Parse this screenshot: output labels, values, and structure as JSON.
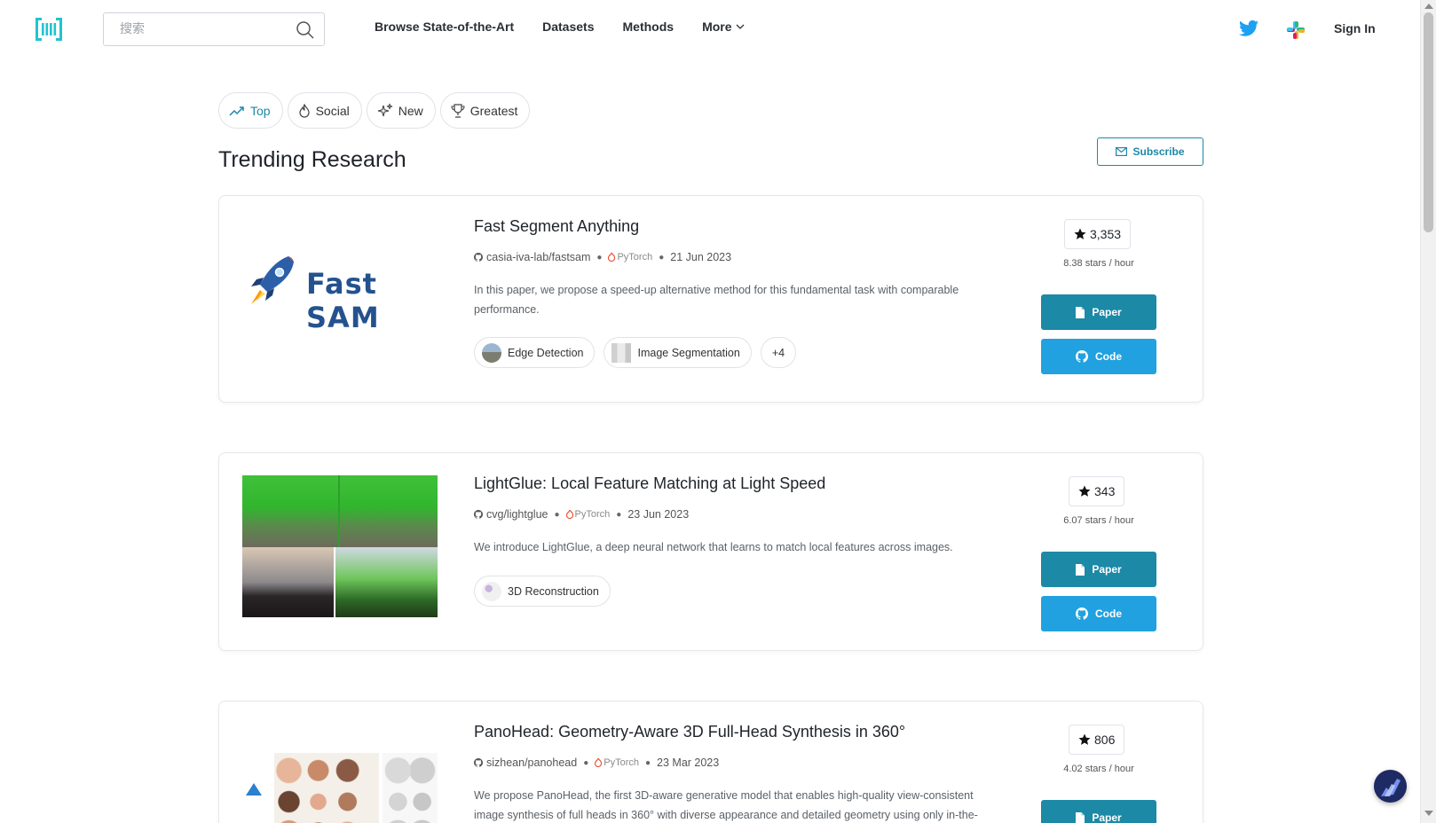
{
  "nav": {
    "search_placeholder": "搜索",
    "links": [
      "Browse State-of-the-Art",
      "Datasets",
      "Methods",
      "More"
    ],
    "signin": "Sign In"
  },
  "tabs": [
    {
      "label": "Top",
      "icon": "trending-up-icon",
      "active": true
    },
    {
      "label": "Social",
      "icon": "flame-icon",
      "active": false
    },
    {
      "label": "New",
      "icon": "sparkle-icon",
      "active": false
    },
    {
      "label": "Greatest",
      "icon": "trophy-icon",
      "active": false
    }
  ],
  "page_title": "Trending Research",
  "subscribe_label": "Subscribe",
  "colors": {
    "accent": "#1c89a6",
    "code_button": "#21a1e0"
  },
  "papers": [
    {
      "title": "Fast Segment Anything",
      "repo": "casia-iva-lab/fastsam",
      "framework": "PyTorch",
      "date": "21 Jun 2023",
      "description": "In this paper, we propose a speed-up alternative method for this fundamental task with comparable performance.",
      "tasks": [
        "Edge Detection",
        "Image Segmentation"
      ],
      "more_tasks": "+4",
      "stars": "3,353",
      "rate": "8.38 stars / hour",
      "thumb_text": "Fast SAM"
    },
    {
      "title": "LightGlue: Local Feature Matching at Light Speed",
      "repo": "cvg/lightglue",
      "framework": "PyTorch",
      "date": "23 Jun 2023",
      "description": "We introduce LightGlue, a deep neural network that learns to match local features across images.",
      "tasks": [
        "3D Reconstruction"
      ],
      "stars": "343",
      "rate": "6.07 stars / hour"
    },
    {
      "title": "PanoHead: Geometry-Aware 3D Full-Head Synthesis in 360°",
      "repo": "sizhean/panohead",
      "framework": "PyTorch",
      "date": "23 Mar 2023",
      "description": "We propose PanoHead, the first 3D-aware generative model that enables high-quality view-consistent image synthesis of full heads in 360° with diverse appearance and detailed geometry using only in-the-",
      "stars": "806",
      "rate": "4.02 stars / hour"
    }
  ],
  "buttons": {
    "paper": "Paper",
    "code": "Code"
  }
}
